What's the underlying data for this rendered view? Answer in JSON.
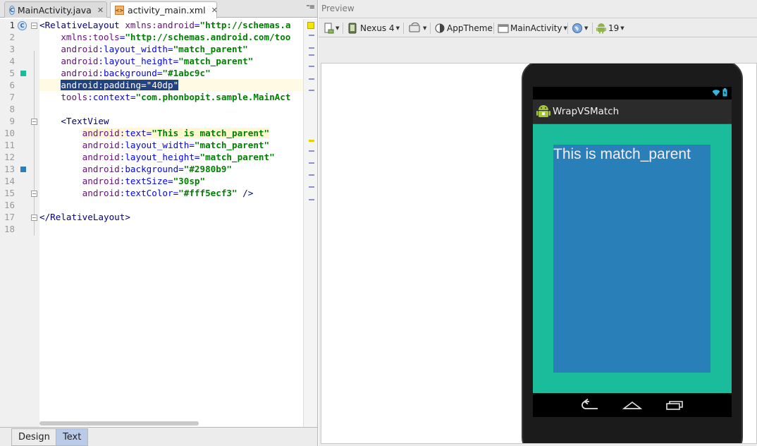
{
  "editor": {
    "tabs": [
      {
        "label": "MainActivity.java",
        "icon": "java-class-icon",
        "active": false
      },
      {
        "label": "activity_main.xml",
        "icon": "xml-file-icon",
        "active": true
      }
    ],
    "tab_overflow": "⁼≡",
    "line_numbers": [
      "1",
      "2",
      "3",
      "4",
      "5",
      "6",
      "7",
      "8",
      "9",
      "10",
      "11",
      "12",
      "13",
      "14",
      "15",
      "16",
      "17",
      "18"
    ],
    "code": {
      "l1_open": "<RelativeLayout ",
      "l1_ns": "xmlns:android",
      "l1_eq": "=",
      "l1_val": "\"http://schemas.a",
      "l2_ns": "xmlns:tools",
      "l2_val": "\"http://schemas.android.com/too",
      "l3_ns": "android",
      "l3_attr": ":layout_width",
      "l3_val": "\"match_parent\"",
      "l4_ns": "android",
      "l4_attr": ":layout_height",
      "l4_val": "\"match_parent\"",
      "l5_ns": "android",
      "l5_attr": ":background",
      "l5_val": "\"#1abc9c\"",
      "l6_sel": "android:padding=\"40dp\"",
      "l7_ns": "tools",
      "l7_attr": ":context",
      "l7_val": "\"com.phonbopit.sample.MainAct",
      "l9_open": "<TextView",
      "l10_ns": "android",
      "l10_attr": ":text",
      "l10_val": "\"This is match_parent\"",
      "l11_ns": "android",
      "l11_attr": ":layout_width",
      "l11_val": "\"match_parent\"",
      "l12_ns": "android",
      "l12_attr": ":layout_height",
      "l12_val": "\"match_parent\"",
      "l13_ns": "android",
      "l13_attr": ":background",
      "l13_val": "\"#2980b9\"",
      "l14_ns": "android",
      "l14_attr": ":textSize",
      "l14_val": "\"30sp\"",
      "l15_ns": "android",
      "l15_attr": ":textColor",
      "l15_val": "\"#fff5ecf3\"",
      "l15_close": " />",
      "l17_close": "</RelativeLayout>"
    },
    "bottom_tabs": [
      {
        "label": "Design",
        "active": false
      },
      {
        "label": "Text",
        "active": true
      }
    ]
  },
  "preview": {
    "title": "Preview",
    "toolbar": {
      "device": "Nexus 4",
      "theme": "AppTheme",
      "activity": "MainActivity",
      "api_level": "19"
    },
    "phone": {
      "app_name": "WrapVSMatch",
      "layout_background": "#1abc9c",
      "textview_background": "#2980b9",
      "textview_text": "This is match_parent",
      "textview_text_color": "#f5ecf3"
    }
  },
  "colors": {
    "layout_bg_swatch": "#1abc9c",
    "textview_bg_swatch": "#2980b9"
  }
}
